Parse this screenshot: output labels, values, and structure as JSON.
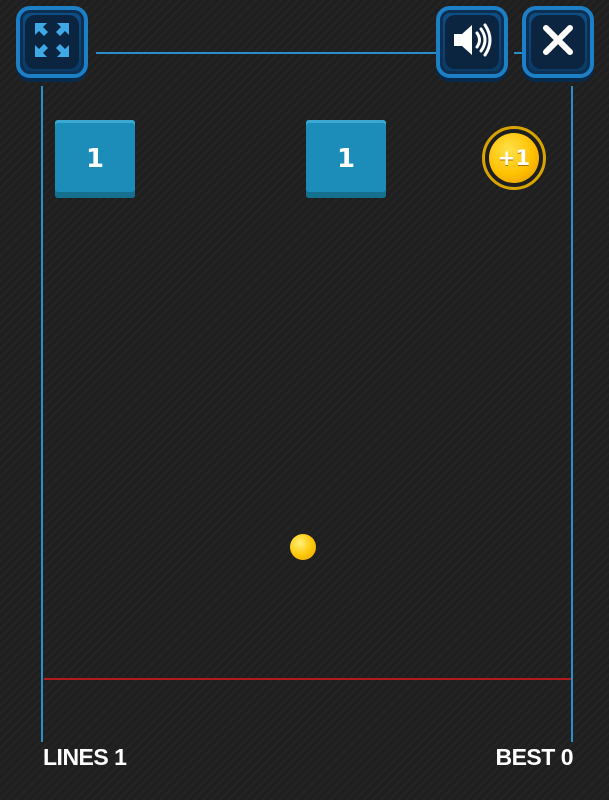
{
  "hud": {
    "lines_text": "LINES 1",
    "best_text": "BEST 0"
  },
  "bricks": [
    {
      "hits": "1"
    },
    {
      "hits": "1"
    }
  ],
  "bonus": {
    "label": "+1"
  },
  "colors": {
    "brick": "#1b8db8",
    "wall": "#2a8fc8",
    "floor_line": "#b01c1c",
    "ball": "#ffc90a",
    "button_border": "#1d7fc6"
  },
  "icons": {
    "fullscreen": "fullscreen-icon",
    "sound": "speaker-icon",
    "close": "close-icon"
  }
}
